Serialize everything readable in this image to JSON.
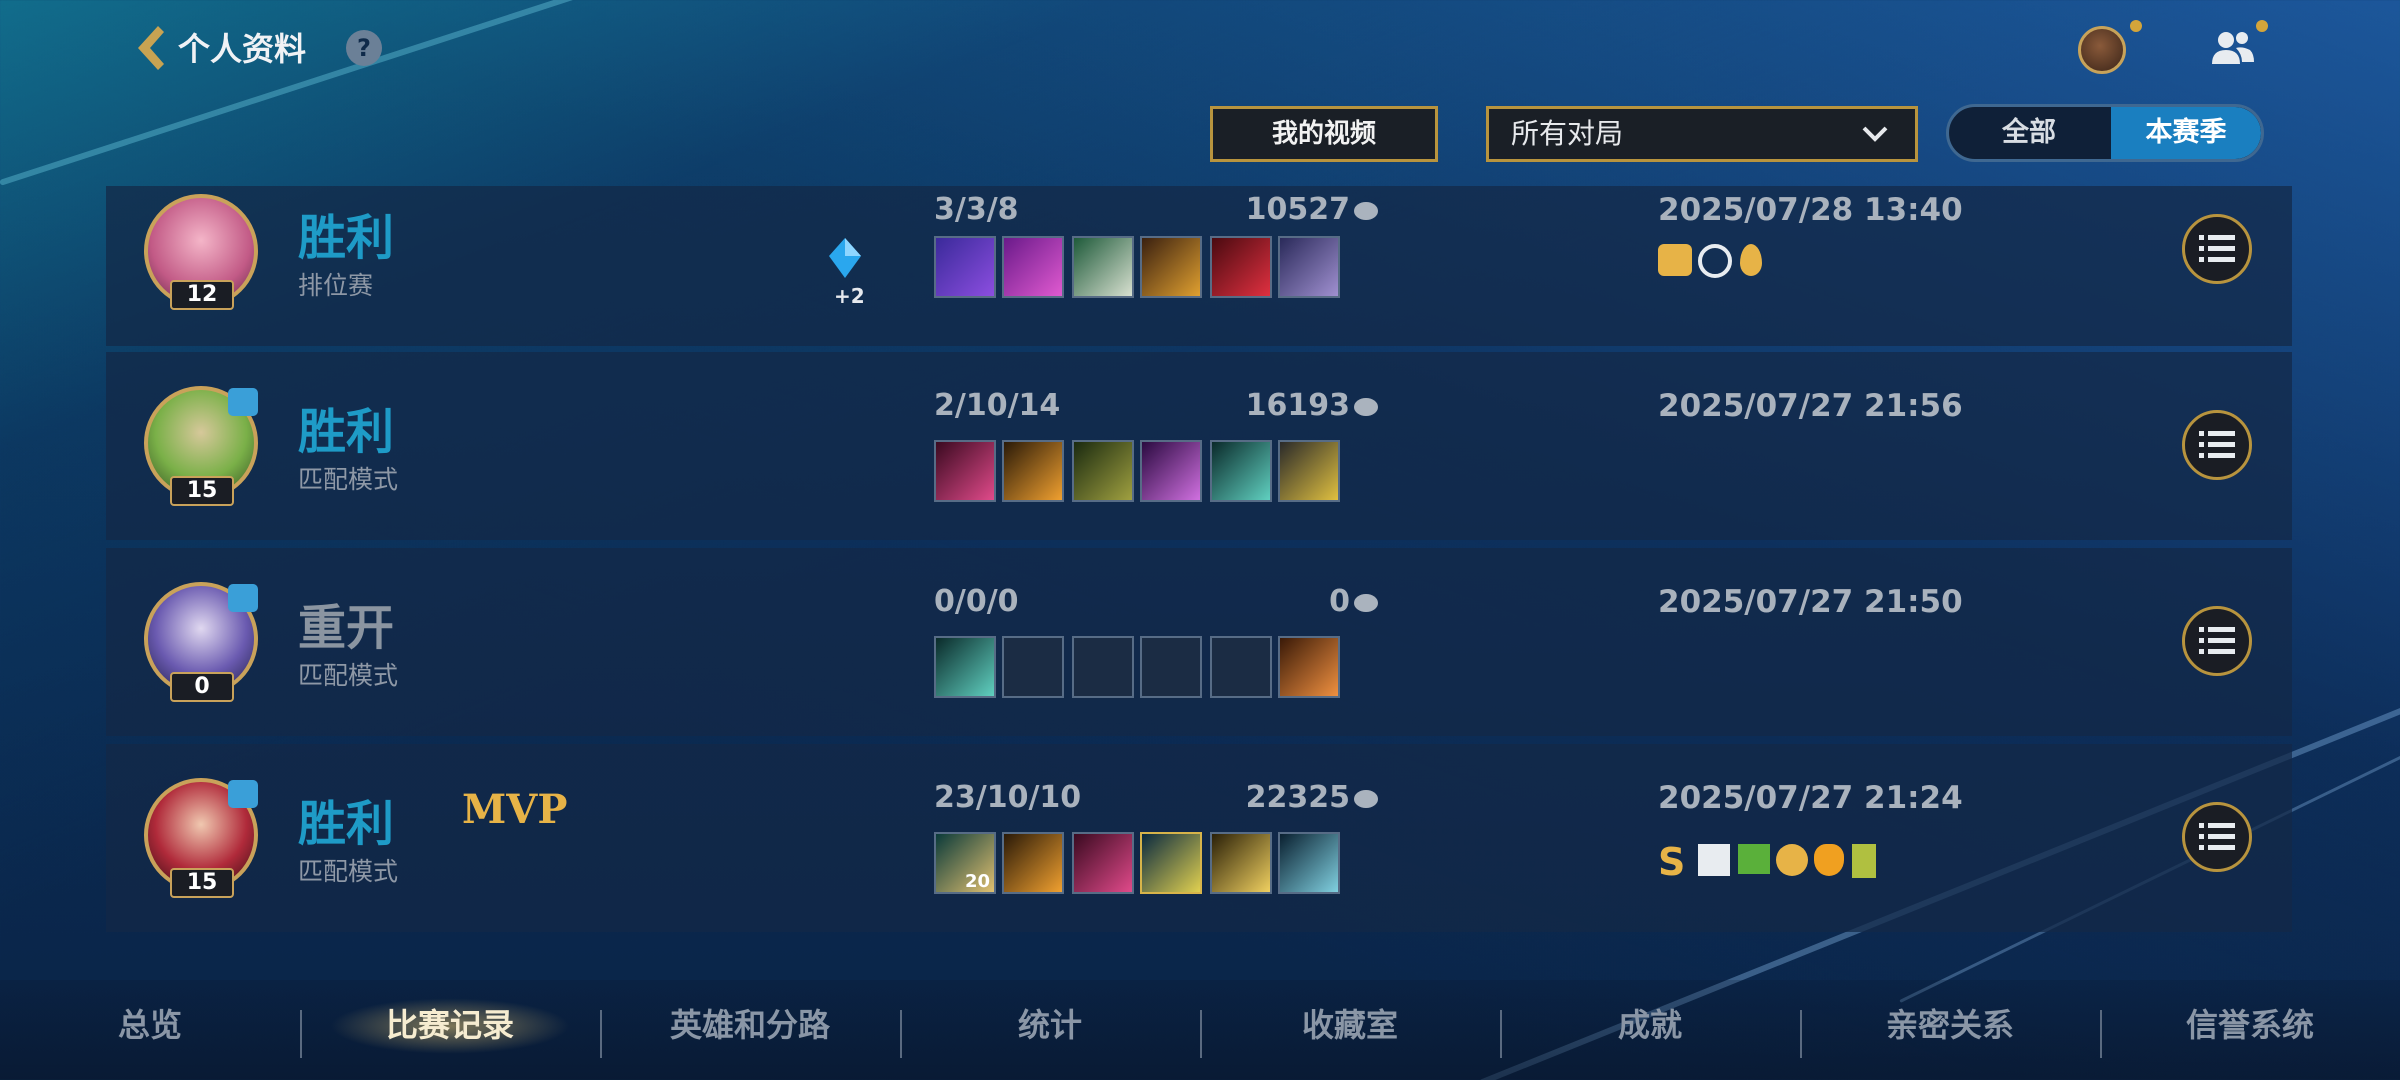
{
  "header": {
    "title": "个人资料",
    "help_icon": "?"
  },
  "controls": {
    "video_button": "我的视频",
    "match_filter": "所有对局",
    "scope_options": [
      "全部",
      "本赛季"
    ],
    "scope_selected": "本赛季"
  },
  "matches": [
    {
      "level": "12",
      "result": "胜利",
      "mode": "排位赛",
      "lp_change": "+2",
      "kda": "3/3/8",
      "gold": "10527",
      "date": "2025/07/28 13:40",
      "result_color": "#1e9bc7"
    },
    {
      "level": "15",
      "result": "胜利",
      "mode": "匹配模式",
      "kda": "2/10/14",
      "gold": "16193",
      "date": "2025/07/27 21:56",
      "result_color": "#1e9bc7"
    },
    {
      "level": "0",
      "result": "重开",
      "mode": "匹配模式",
      "kda": "0/0/0",
      "gold": "0",
      "date": "2025/07/27 21:50",
      "result_color": "#8b95a1"
    },
    {
      "level": "15",
      "result": "胜利",
      "mode": "匹配模式",
      "mvp": "MVP",
      "kda": "23/10/10",
      "gold": "22325",
      "date": "2025/07/27 21:24",
      "item_stack": "20",
      "result_color": "#1e9bc7"
    }
  ],
  "nav": {
    "tabs": [
      "总览",
      "比赛记录",
      "英雄和分路",
      "统计",
      "收藏室",
      "成就",
      "亲密关系",
      "信誉系统"
    ],
    "active": "比赛记录"
  },
  "colors": {
    "accent_gold": "#b8943e",
    "win_blue": "#1e9bc7",
    "selected_blue": "#1a7fc0"
  }
}
